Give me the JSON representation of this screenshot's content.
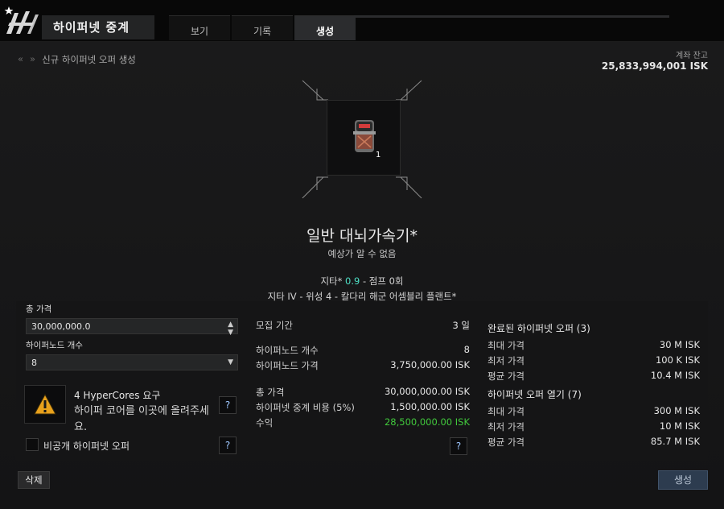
{
  "header": {
    "title": "하이퍼넷 중계",
    "tabs": [
      {
        "label": "보기",
        "active": false
      },
      {
        "label": "기록",
        "active": false
      },
      {
        "label": "생성",
        "active": true
      }
    ]
  },
  "breadcrumb": {
    "text": "신규 하이퍼넷 오퍼 생성"
  },
  "balance": {
    "label": "계좌 잔고",
    "value": "25,833,994,001 ISK"
  },
  "item": {
    "quantity": "1",
    "name": "일반 대뇌가속기*",
    "subtitle": "예상가 알 수 없음",
    "location_system": "지타*",
    "security": "0.9",
    "location_jumps": "- 점프 0회",
    "station": "지타 IV - 위성 4 - 칼다리 해군 어셈블리 플랜트*"
  },
  "form": {
    "total_price_label": "총 가격",
    "total_price_value": "30,000,000.0",
    "nodes_label": "하이퍼노드 개수",
    "nodes_value": "8",
    "hypercore_required": "4 HyperCores 요구",
    "hypercore_hint": "하이퍼 코어를 이곳에 올려주세요.",
    "private_label": "비공개 하이퍼넷 오퍼",
    "help": "?"
  },
  "summary": {
    "duration": {
      "label": "모집 기간",
      "value": "3 일"
    },
    "node_count": {
      "label": "하이퍼노드 개수",
      "value": "8"
    },
    "node_price": {
      "label": "하이퍼노드 가격",
      "value": "3,750,000.00 ISK"
    },
    "total": {
      "label": "총 가격",
      "value": "30,000,000.00 ISK"
    },
    "fee": {
      "label": "하이퍼넷 중계 비용 (5%)",
      "value": "1,500,000.00 ISK"
    },
    "profit": {
      "label": "수익",
      "value": "28,500,000.00 ISK"
    }
  },
  "stats": {
    "completed_title": "완료된 하이퍼넷 오퍼 (3)",
    "completed": [
      {
        "label": "최대 가격",
        "value": "30 M ISK"
      },
      {
        "label": "최저 가격",
        "value": "100 K ISK"
      },
      {
        "label": "평균 가격",
        "value": "10.4 M ISK"
      }
    ],
    "open_title": "하이퍼넷 오퍼 열기 (7)",
    "open": [
      {
        "label": "최대 가격",
        "value": "300 M ISK"
      },
      {
        "label": "최저 가격",
        "value": "10 M ISK"
      },
      {
        "label": "평균 가격",
        "value": "85.7 M ISK"
      }
    ]
  },
  "buttons": {
    "delete": "삭제",
    "create": "생성"
  },
  "colors": {
    "security": "#4ee0c6",
    "profit": "#41c93c",
    "accent": "#2d3c4f"
  }
}
